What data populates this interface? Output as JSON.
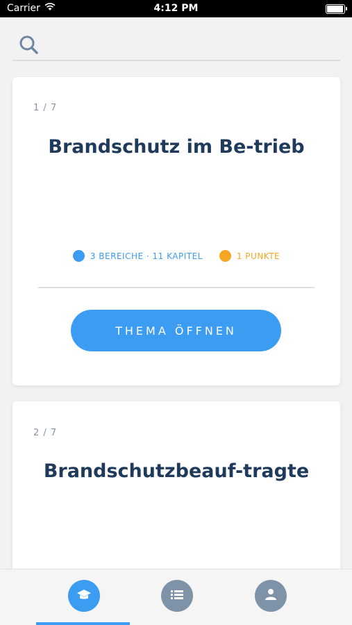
{
  "status_bar": {
    "carrier": "Carrier",
    "time": "4:12 PM",
    "battery_level": 0.95
  },
  "search": {
    "icon": "search-icon"
  },
  "cards": [
    {
      "counter": "1 / 7",
      "title": "Brandschutz im Be-trieb",
      "sections": "3 BEREICHE · 11 KAPITEL",
      "points": "1 PUNKTE",
      "button_label": "THEMA ÖFFNEN"
    },
    {
      "counter": "2 / 7",
      "title": "Brandschutzbeauf-tragte"
    }
  ],
  "tab_bar": {
    "tabs": [
      {
        "icon": "graduation-cap-icon",
        "active": true
      },
      {
        "icon": "list-icon",
        "active": false
      },
      {
        "icon": "person-icon",
        "active": false
      }
    ]
  },
  "colors": {
    "accent": "#3b9cf1",
    "points": "#f7a623",
    "title": "#1f3a5a",
    "inactive_tab": "#7f93a8"
  }
}
